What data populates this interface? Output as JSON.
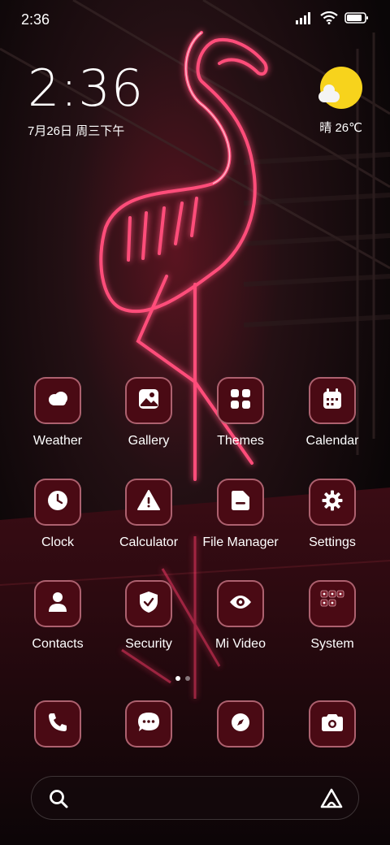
{
  "status_bar": {
    "time": "2:36",
    "battery_level": 0.85
  },
  "clock_widget": {
    "time": "2:36",
    "date": "7月26日 周三下午"
  },
  "weather_widget": {
    "condition_icon": "sunny-cloud-icon",
    "text": "晴 26℃"
  },
  "apps": [
    {
      "label": "Weather",
      "icon": "cloud-icon"
    },
    {
      "label": "Gallery",
      "icon": "image-icon"
    },
    {
      "label": "Themes",
      "icon": "grid-icon"
    },
    {
      "label": "Calendar",
      "icon": "calendar-icon"
    },
    {
      "label": "Clock",
      "icon": "clock-icon"
    },
    {
      "label": "Calculator",
      "icon": "warning-triangle-icon"
    },
    {
      "label": "File Manager",
      "icon": "folder-icon"
    },
    {
      "label": "Settings",
      "icon": "gear-icon"
    },
    {
      "label": "Contacts",
      "icon": "person-icon"
    },
    {
      "label": "Security",
      "icon": "shield-check-icon"
    },
    {
      "label": "Mi Video",
      "icon": "eye-icon"
    },
    {
      "label": "System",
      "icon": "folder-grid-icon"
    }
  ],
  "page_indicator": {
    "pages": 2,
    "current": 1
  },
  "dock": [
    {
      "icon": "phone-icon"
    },
    {
      "icon": "message-icon"
    },
    {
      "icon": "compass-icon"
    },
    {
      "icon": "camera-icon"
    }
  ],
  "search_bar": {
    "search_icon": "search-icon",
    "assistant_icon": "assistant-icon"
  },
  "colors": {
    "tile_bg": "#4a0a14",
    "tile_border": "#ffaab9",
    "sun": "#f7d31c",
    "neon": "#ff2e63"
  }
}
